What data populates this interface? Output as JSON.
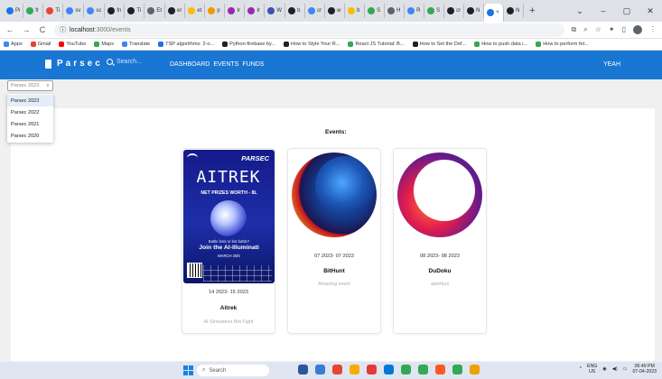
{
  "browser": {
    "tabs": [
      {
        "label": "Pi",
        "color": "#1a73e8"
      },
      {
        "label": "fr",
        "color": "#34a853"
      },
      {
        "label": "Ti",
        "color": "#ea4335"
      },
      {
        "label": "sv",
        "color": "#4285f4"
      },
      {
        "label": "sc",
        "color": "#4285f4"
      },
      {
        "label": "fn",
        "color": "#202124"
      },
      {
        "label": "Ti",
        "color": "#202124"
      },
      {
        "label": "Et",
        "color": "#5f6368"
      },
      {
        "label": "er",
        "color": "#202124"
      },
      {
        "label": "et",
        "color": "#fbbc05"
      },
      {
        "label": "p",
        "color": "#f29900"
      },
      {
        "label": "Ir",
        "color": "#9c27b0"
      },
      {
        "label": "Ir",
        "color": "#9c27b0"
      },
      {
        "label": "W",
        "color": "#3f51b5"
      },
      {
        "label": "b",
        "color": "#202124"
      },
      {
        "label": "cr",
        "color": "#4285f4"
      },
      {
        "label": "w",
        "color": "#202124"
      },
      {
        "label": "b",
        "color": "#fbbc05"
      },
      {
        "label": "S",
        "color": "#34a853"
      },
      {
        "label": "H",
        "color": "#5f6368"
      },
      {
        "label": "R",
        "color": "#4285f4"
      },
      {
        "label": "S",
        "color": "#34a853"
      },
      {
        "label": "cr",
        "color": "#202124"
      },
      {
        "label": "N",
        "color": "#202124"
      },
      {
        "label": "×",
        "color": "#1a73e8",
        "active": true
      },
      {
        "label": "N",
        "color": "#202124"
      }
    ],
    "newtab_label": "+",
    "window_controls": {
      "dropdown": "⌄",
      "minimize": "–",
      "maximize": "▢",
      "close": "✕"
    },
    "nav": {
      "back": "←",
      "forward": "→",
      "reload": "C"
    },
    "url": {
      "host": "localhost",
      "rest": ":3000/events",
      "info_icon": "ⓘ"
    },
    "bookmarks": [
      {
        "label": "Apps",
        "color": "#4285f4"
      },
      {
        "label": "Gmail",
        "color": "#ea4335"
      },
      {
        "label": "YouTube",
        "color": "#ff0000"
      },
      {
        "label": "Maps",
        "color": "#34a853"
      },
      {
        "label": "Translate",
        "color": "#4285f4"
      },
      {
        "label": "TSP algorithms: 2-o...",
        "color": "#1a73e8"
      },
      {
        "label": "Python-firebase by...",
        "color": "#202124"
      },
      {
        "label": "How to Style Your R...",
        "color": "#202124"
      },
      {
        "label": "React JS Tutorial: B...",
        "color": "#34a853"
      },
      {
        "label": "How to Set the Def...",
        "color": "#202124"
      },
      {
        "label": "How to push data i...",
        "color": "#34a853"
      },
      {
        "label": "How to perform fet...",
        "color": "#34a853"
      }
    ]
  },
  "app": {
    "brand": "Parsec",
    "search_placeholder": "Search...",
    "nav_links": [
      "DASHBOARD",
      "EVENTS",
      "FUNDS"
    ],
    "user": "YEAH",
    "year_select": {
      "value": "Parsec 2023",
      "caret": "∨",
      "options": [
        "Parsec 2023",
        "Parsec 2022",
        "Parsec 2021",
        "Parsec 2020"
      ]
    },
    "events_title": "Events:",
    "events": [
      {
        "dates": "14 2023- 15 2023",
        "name": "Aitrek",
        "description": "AI Simulation Bot Fight"
      },
      {
        "dates": "07 2023- 07 2023",
        "name": "BitHunt",
        "description": "Amazing event"
      },
      {
        "dates": "08 2023- 08 2023",
        "name": "DuDoku",
        "description": "qwertyui"
      }
    ],
    "poster": {
      "tag": "PARSEC",
      "headline": "AITREK",
      "prize": "NET PRIZES WORTH - 8L",
      "question": "Battle bots or bot battle?",
      "join": "Join the AI-Illuminati",
      "date": "MARCH 25th"
    }
  },
  "taskbar": {
    "search_label": "Search",
    "icon_colors": [
      "#2b579a",
      "#3a7bd5",
      "#ea4335",
      "#f9ab00",
      "#e53935",
      "#0078d4",
      "#34a853",
      "#34a853",
      "#ff5722",
      "#34a853",
      "#f0a000"
    ],
    "lang": "ENG",
    "region": "US",
    "time": "06:49 PM",
    "date": "07-04-2023",
    "tray_caret": "^"
  }
}
